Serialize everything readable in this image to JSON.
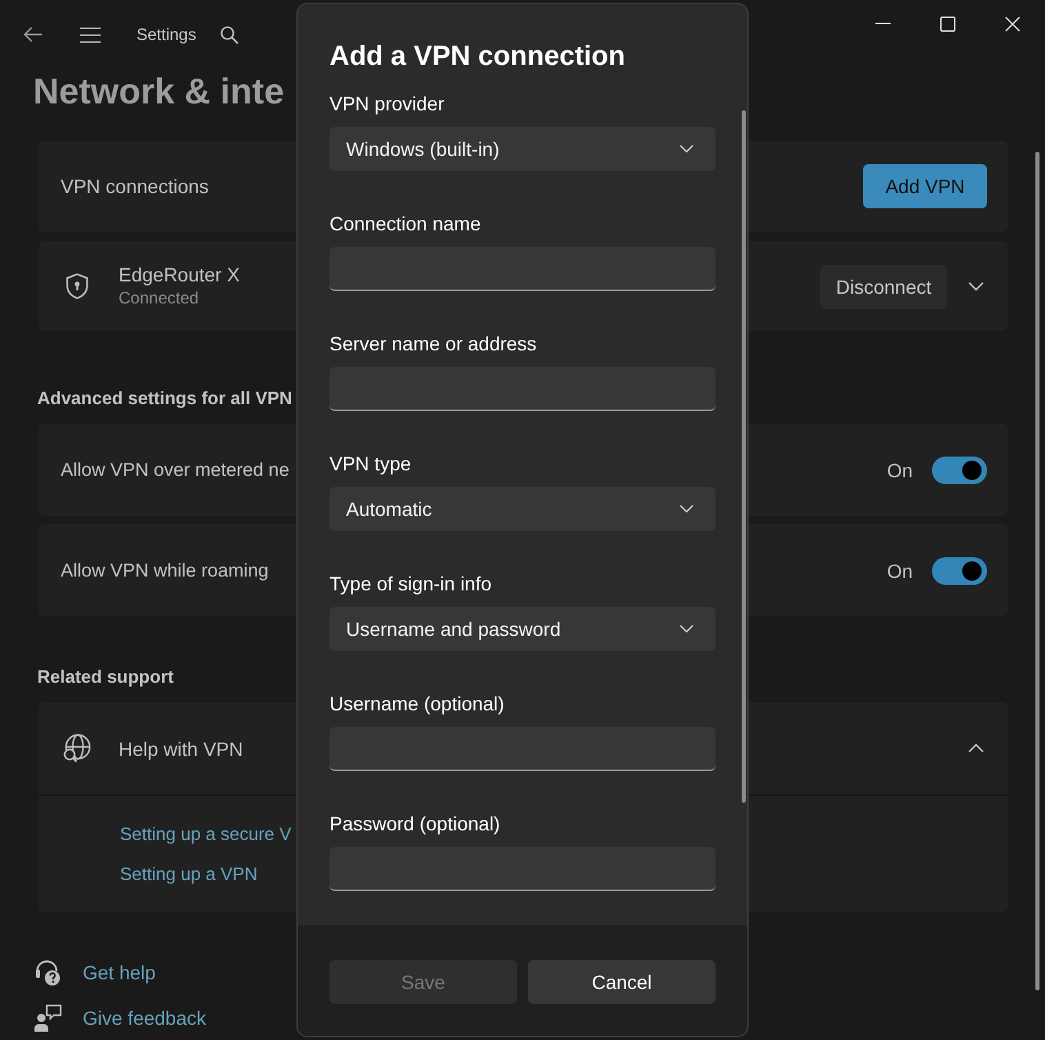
{
  "window": {
    "title": "Settings"
  },
  "page": {
    "heading": "Network & inte"
  },
  "vpn_connections": {
    "label": "VPN connections",
    "button": "Add VPN"
  },
  "connections": [
    {
      "name": "EdgeRouter X",
      "status": "Connected",
      "button": "Disconnect",
      "expanded": false
    }
  ],
  "advanced": {
    "heading": "Advanced settings for all VPN",
    "settings": [
      {
        "label": "Allow VPN over metered ne",
        "state_text": "On",
        "on": true
      },
      {
        "label": "Allow VPN while roaming",
        "state_text": "On",
        "on": true
      }
    ]
  },
  "related_support": {
    "heading": "Related support",
    "items": [
      {
        "label": "Help with VPN",
        "expanded": true,
        "links": [
          "Setting up a secure V",
          "Setting up a VPN"
        ]
      }
    ]
  },
  "help_links": [
    {
      "kind": "help",
      "label": "Get help"
    },
    {
      "kind": "feedback",
      "label": "Give feedback"
    }
  ],
  "dialog": {
    "title": "Add a VPN connection",
    "fields": [
      {
        "kind": "dropdown",
        "label": "VPN provider",
        "value": "Windows (built-in)"
      },
      {
        "kind": "text",
        "label": "Connection name"
      },
      {
        "kind": "text",
        "label": "Server name or address"
      },
      {
        "kind": "dropdown",
        "label": "VPN type",
        "value": "Automatic"
      },
      {
        "kind": "dropdown",
        "label": "Type of sign-in info",
        "value": "Username and password"
      },
      {
        "kind": "text",
        "label": "Username (optional)"
      },
      {
        "kind": "text",
        "label": "Password (optional)"
      }
    ],
    "buttons": [
      {
        "label": "Save",
        "disabled": true
      },
      {
        "label": "Cancel",
        "disabled": false
      }
    ]
  }
}
